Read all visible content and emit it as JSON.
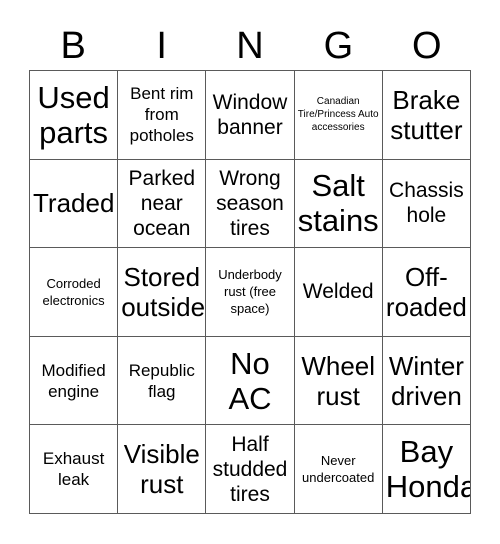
{
  "card": {
    "header_letters": [
      "B",
      "I",
      "N",
      "G",
      "O"
    ],
    "rows": [
      [
        {
          "text": "Used parts",
          "size": "xxl"
        },
        {
          "text": "Bent rim from potholes",
          "size": "m"
        },
        {
          "text": "Window banner",
          "size": "l"
        },
        {
          "text": "Canadian Tire/Princess Auto accessories",
          "size": "xs"
        },
        {
          "text": "Brake stutter",
          "size": "xl"
        }
      ],
      [
        {
          "text": "Traded",
          "size": "xl"
        },
        {
          "text": "Parked near ocean",
          "size": "l"
        },
        {
          "text": "Wrong season tires",
          "size": "l"
        },
        {
          "text": "Salt stains",
          "size": "xxl"
        },
        {
          "text": "Chassis hole",
          "size": "l"
        }
      ],
      [
        {
          "text": "Corroded electronics",
          "size": "s"
        },
        {
          "text": "Stored outside",
          "size": "xl"
        },
        {
          "text": "Underbody rust (free space)",
          "size": "s"
        },
        {
          "text": "Welded",
          "size": "l"
        },
        {
          "text": "Off-roaded",
          "size": "xl"
        }
      ],
      [
        {
          "text": "Modified engine",
          "size": "m"
        },
        {
          "text": "Republic flag",
          "size": "m"
        },
        {
          "text": "No AC",
          "size": "xxl"
        },
        {
          "text": "Wheel rust",
          "size": "xl"
        },
        {
          "text": "Winter driven",
          "size": "xl"
        }
      ],
      [
        {
          "text": "Exhaust leak",
          "size": "m"
        },
        {
          "text": "Visible rust",
          "size": "xl"
        },
        {
          "text": "Half studded tires",
          "size": "l"
        },
        {
          "text": "Never undercoated",
          "size": "s"
        },
        {
          "text": "Bay Honda",
          "size": "xxl"
        }
      ]
    ]
  },
  "colors": {
    "background": "#ffffff",
    "text": "#000000",
    "grid_line": "#5a5a5a"
  }
}
